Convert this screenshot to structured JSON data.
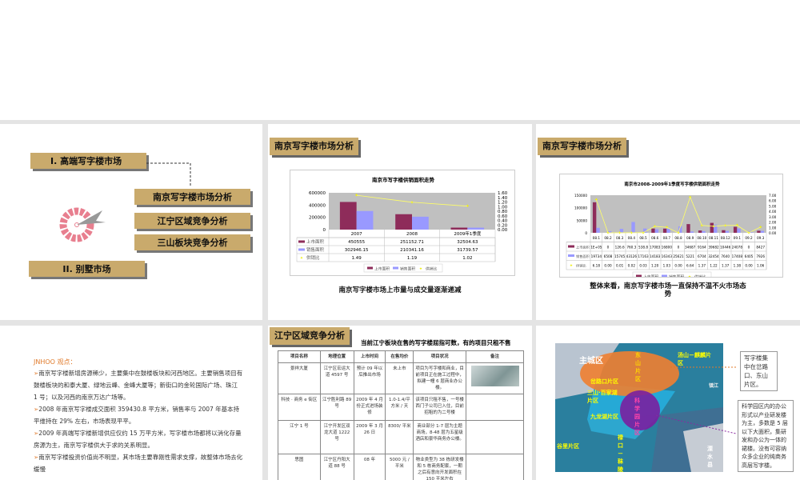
{
  "slide1": {
    "section1": "I.   高端写字楼市场",
    "sub_items": [
      "南京写字楼市场分析",
      "江宁区域竞争分析",
      "三山板块竞争分析"
    ],
    "section2": "II.  别墅市场"
  },
  "slide2": {
    "title": "南京写字楼市场分析",
    "caption": "南京写字楼市场上市量与成交量逐渐递减"
  },
  "slide3": {
    "title": "南京写字楼市场分析",
    "caption_line1": "整体来看，南京写字楼市场一直保持不温不火市场态",
    "caption_line2": "势"
  },
  "slide4": {
    "heading": "JNHOO 观点：",
    "bullets": [
      "南京写字楼新增房源稀少，主要集中在鼓楼板块和河西地区。主要销售项目有鼓楼板块的和泰大厦、绿地云峰、金峰大厦等；新街口的金轮国际广场、珠江 1 号；以及河西的南京万达广场等。",
      "2008 年南京写字楼成交面积 359430.8 平方米，销售率与 2007 年基本持平维持在 29% 左右，市场表现平平。",
      "2009 年高端写字楼新增供应仅约 15 万平方米，写字楼市场都将以消化存量房源为主，南京写字楼供大于求的关系明显。",
      "南京写字楼投资价值尚不明显，其市场主要靠刚性需求支撑，故整体市场去化缓慢"
    ]
  },
  "slide5": {
    "title": "江宁区域竞争分析",
    "subtitle": "当前江宁板块在售的写字楼屈指可数，有的项目只租不售",
    "table": {
      "headers": [
        "项目名称",
        "地理位置",
        "上市时间",
        "在售均价",
        "项目状况",
        "备注"
      ],
      "rows": [
        [
          "景祥大厦",
          "江宁区宏运大道 4597 号",
          "预计 09 年以后推出市场",
          "未上市",
          "项目为写字楼和商业，目前项目正在施工过程中，拟建一幢 6 层商业办公楼。",
          ""
        ],
        [
          "科技 · 商务 e 街区",
          "江宁胜利路 89 号",
          "2009 年 4 月份正式进场装修",
          "1.0-1.4/平方米 / 天",
          "该项目只租不售，一号楼西门子公司已入住，目前招租的为二号楼",
          ""
        ],
        [
          "江宁 1 号",
          "江宁开发区双龙大道 1222 号",
          "2009 年 3 月 26 日",
          "8300/ 平米",
          "商业部分 1-7 层为主题商场，8-48 层为五星级酒店和豪华商务办公楼。",
          ""
        ],
        [
          "思图",
          "江宁区丹阳大道 88 号",
          "08 年",
          "5000 元 / 平米",
          "物业类型为 38 栋研发楼和 5 栋商务配套，一期之后有意向开发面积在 150 平米左右",
          ""
        ]
      ]
    }
  },
  "slide6": {
    "map_labels": [
      "主城区",
      "东山片区",
      "汤山－麒麟片区",
      "岔路口片区",
      "三山·百家湖片区",
      "科学园片区",
      "九龙湖片区",
      "禄口－秣陵片区",
      "谷里片区",
      "溧水县",
      "镇江"
    ],
    "callout1": "写字楼集中在岔路口、东山片区。",
    "callout2": "科学园区内的办公形式以产业研发楼为主，多数是 5 层以下大面积，集研发和办公为一体的裙楼。没有可容纳众多企业的纯商务高层写字楼。"
  },
  "colors": {
    "bar1": "#8e2c5a",
    "bar2": "#9999ff",
    "line": "#ffff66",
    "plot_bg": "#c0c0c0",
    "title_bg": "#c9aa6c"
  },
  "chart_data": [
    {
      "type": "bar",
      "title": "南京市写字楼供销面积走势",
      "categories": [
        "2007",
        "2008",
        "2009年1季度"
      ],
      "series": [
        {
          "name": "上市面积",
          "values": [
            450555,
            251152.71,
            32504.63
          ],
          "labels": [
            "450555",
            "251152.71",
            "32504.63"
          ]
        },
        {
          "name": "销售面积",
          "values": [
            302946.15,
            210341.16,
            31739.57
          ],
          "labels": [
            "302946.15",
            "210341.16",
            "31739.57"
          ]
        },
        {
          "name": "供销比",
          "axis": "right",
          "values": [
            1.49,
            1.19,
            1.02
          ],
          "labels": [
            "1.49",
            "1.19",
            "1.02"
          ]
        }
      ],
      "yticks": [
        "600000",
        "400000",
        "200000",
        "0"
      ],
      "ylim": [
        0,
        600000
      ],
      "y2ticks": [
        "1.60",
        "1.40",
        "1.20",
        "1.00",
        "0.80",
        "0.60",
        "0.40",
        "0.20",
        "0.00"
      ],
      "y2lim": [
        0,
        1.6
      ],
      "legend": "bottom"
    },
    {
      "type": "bar",
      "title": "南京市2008-2009年1季度写字楼供销面积走势",
      "categories": [
        "08.1",
        "08.2",
        "08.3",
        "08.4",
        "08.5",
        "08.6",
        "08.7",
        "08.8",
        "08.9",
        "08.10",
        "08.11",
        "08.12",
        "09.1",
        "09.2",
        "09.3"
      ],
      "series": [
        {
          "name": "上市面积",
          "values": [
            121900,
            0,
            126.6,
            760.3,
            538.8,
            17083,
            16800,
            0,
            34687,
            9164,
            39682,
            10446,
            24078,
            0,
            8427
          ],
          "labels": [
            "1E+05",
            "0",
            "126.6",
            "760.3",
            "538.8",
            "17083",
            "16800",
            "0",
            "34687",
            "9164",
            "39682",
            "10446",
            "24078",
            "0",
            "8427"
          ]
        },
        {
          "name": "销售面积",
          "values": [
            19734,
            6508,
            15745,
            43126,
            17163,
            14183,
            16343,
            25621,
            5221,
            6704,
            32454,
            7640,
            17408,
            6405,
            7926
          ],
          "labels": [
            "19734",
            "6508",
            "15745",
            "43126",
            "17163",
            "14183",
            "16343",
            "25621",
            "5221",
            "6704",
            "32454",
            "7640",
            "17408",
            "6405",
            "7926"
          ]
        },
        {
          "name": "供销比",
          "axis": "right",
          "values": [
            6.18,
            0,
            0.01,
            0.02,
            0.03,
            1.2,
            1.03,
            0,
            6.64,
            1.37,
            1.22,
            1.37,
            1.38,
            0,
            1.06
          ],
          "labels": [
            "6.18",
            "0.00",
            "0.01",
            "0.02",
            "0.03",
            "1.20",
            "1.03",
            "0.00",
            "6.64",
            "1.37",
            "1.22",
            "1.37",
            "1.38",
            "0.00",
            "1.06"
          ]
        }
      ],
      "yticks": [
        "150000",
        "100000",
        "50000",
        "0"
      ],
      "ylim": [
        0,
        150000
      ],
      "y2ticks": [
        "7.00",
        "6.00",
        "5.00",
        "4.00",
        "3.00",
        "2.00",
        "1.00",
        "0.00"
      ],
      "y2lim": [
        0,
        7
      ],
      "legend": "bottom"
    }
  ]
}
